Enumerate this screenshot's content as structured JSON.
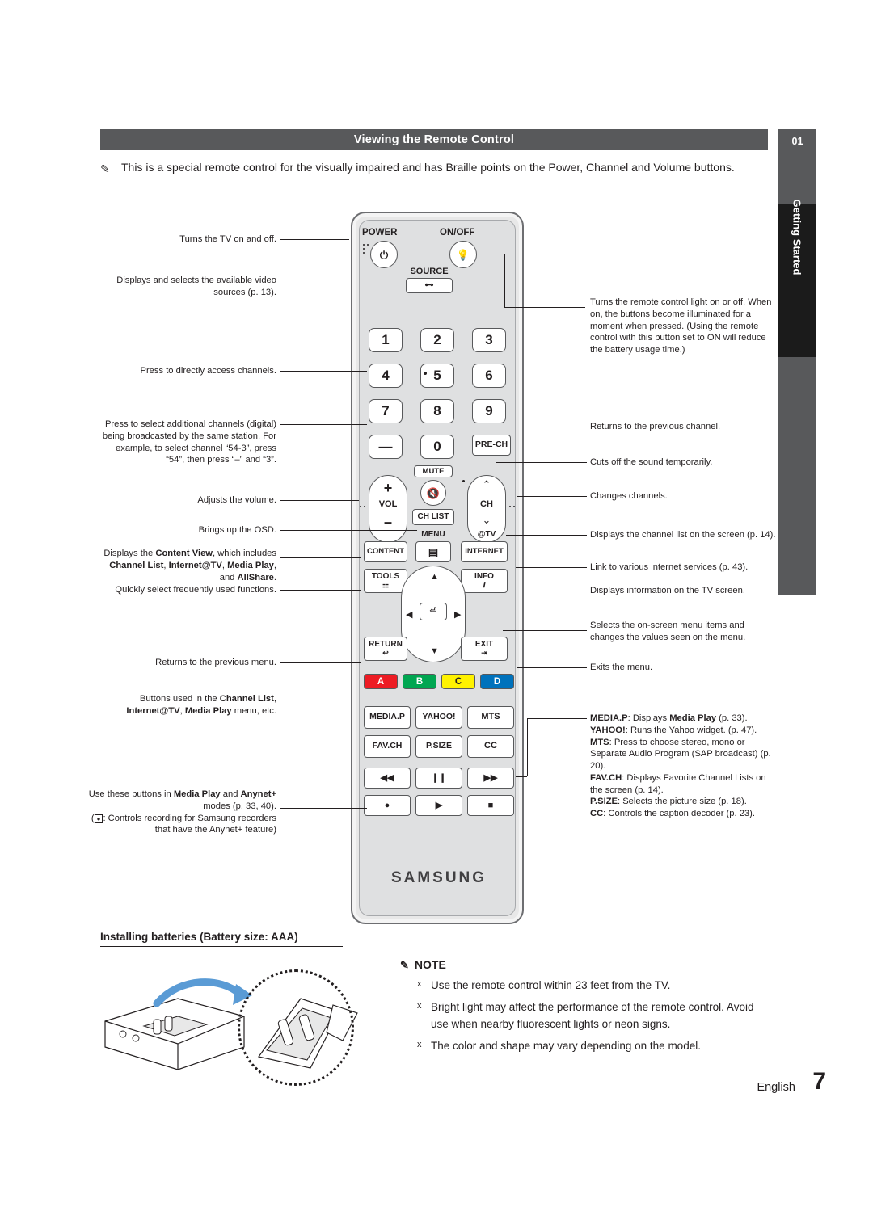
{
  "header": {
    "title": "Viewing the Remote Control"
  },
  "side_tab": {
    "number": "01",
    "label": "Getting Started"
  },
  "intro": {
    "icon": "note-icon",
    "text": "This is a special remote control for the visually impaired and has Braille points on the Power, Channel and Volume buttons."
  },
  "remote": {
    "brand": "SAMSUNG",
    "buttons": {
      "power": "POWER",
      "onoff": "ON/OFF",
      "source": "SOURCE",
      "num1": "1",
      "num2": "2",
      "num3": "3",
      "num4": "4",
      "num5": "5",
      "num6": "6",
      "num7": "7",
      "num8": "8",
      "num9": "9",
      "dash": "—",
      "num0": "0",
      "prech": "PRE-CH",
      "mute": "MUTE",
      "vol": "VOL",
      "vol_plus": "+",
      "vol_minus": "–",
      "ch": "CH",
      "chlist": "CH LIST",
      "menu": "MENU",
      "attv": "@TV",
      "content": "CONTENT",
      "internet": "INTERNET",
      "tools": "TOOLS",
      "info": "INFO",
      "return": "RETURN",
      "exit": "EXIT",
      "a": "A",
      "b": "B",
      "c": "C",
      "d": "D",
      "mediap": "MEDIA.P",
      "yahoo": "YAHOO!",
      "mts": "MTS",
      "favch": "FAV.CH",
      "psize": "P.SIZE",
      "cc": "CC"
    }
  },
  "labels_left": [
    {
      "id": "power",
      "text": "Turns the TV on and off."
    },
    {
      "id": "source",
      "text": "Displays and selects the available video sources (p. 13)."
    },
    {
      "id": "numbers",
      "text": "Press to directly access channels."
    },
    {
      "id": "dash",
      "text": "Press to select additional channels (digital) being broadcasted by the same station. For example, to select channel “54-3”, press “54”, then press “–” and “3”."
    },
    {
      "id": "vol",
      "text": "Adjusts the volume."
    },
    {
      "id": "menu",
      "text": "Brings up the OSD."
    },
    {
      "id": "content",
      "html": "Displays the <b>Content View</b>, which includes <b>Channel List</b>, <b>Internet@TV</b>, <b>Media Play</b>, and <b>AllShare</b>."
    },
    {
      "id": "tools",
      "text": "Quickly select frequently used functions."
    },
    {
      "id": "return",
      "text": "Returns to the previous menu."
    },
    {
      "id": "abcd",
      "html": "Buttons used in the <b>Channel List</b>, <b>Internet@TV</b>, <b>Media Play</b> menu, etc."
    },
    {
      "id": "media",
      "html": "Use these buttons in <b>Media Play</b> and <b>Anynet+</b> modes (p. 33, 40).<br>(●: Controls recording for Samsung recorders that have the Anynet+ feature)"
    }
  ],
  "labels_right": [
    {
      "id": "onoff",
      "text": "Turns the remote control light on or off. When on, the buttons become illuminated for a moment when pressed. (Using the remote control with this button set to ON will reduce the battery usage time.)"
    },
    {
      "id": "prech",
      "text": "Returns to the previous channel."
    },
    {
      "id": "mute",
      "text": "Cuts off the sound temporarily."
    },
    {
      "id": "ch",
      "text": "Changes channels."
    },
    {
      "id": "chlist",
      "text": "Displays the channel list on the screen (p. 14)."
    },
    {
      "id": "internet",
      "text": "Link to various internet services (p. 43)."
    },
    {
      "id": "info",
      "text": "Displays information on the TV screen."
    },
    {
      "id": "pad",
      "text": "Selects the on-screen menu items and changes the values seen on the menu."
    },
    {
      "id": "exit",
      "text": "Exits the menu."
    },
    {
      "id": "media",
      "html": "<b>MEDIA.P</b>: Displays <b>Media Play</b> (p. 33).<br><b>YAHOO!</b>: Runs the Yahoo widget. (p. 47).<br><b>MTS</b>: Press to choose stereo, mono or Separate Audio Program (SAP broadcast) (p. 20).<br><b>FAV.CH</b>: Displays Favorite Channel Lists on the screen (p. 14).<br><b>P.SIZE</b>: Selects the picture size (p. 18).<br><b>CC</b>: Controls the caption decoder (p. 23)."
    }
  ],
  "battery": {
    "title": "Installing batteries (Battery size: AAA)"
  },
  "note": {
    "icon": "note-icon",
    "title": "NOTE",
    "items": [
      "Use the remote control within 23 feet from the TV.",
      "Bright light may affect the performance of the remote control. Avoid use when nearby fluorescent lights or neon signs.",
      "The color and shape may vary depending on the model."
    ]
  },
  "footer": {
    "language": "English",
    "page": "7"
  },
  "colors": {
    "header_bg": "#58595b",
    "tab_dark": "#1b1b1b",
    "btn_a": "#ed1c24",
    "btn_b": "#00a651",
    "btn_c": "#fff200",
    "btn_d": "#0072bc",
    "remote_body": "#e8e8e8"
  }
}
